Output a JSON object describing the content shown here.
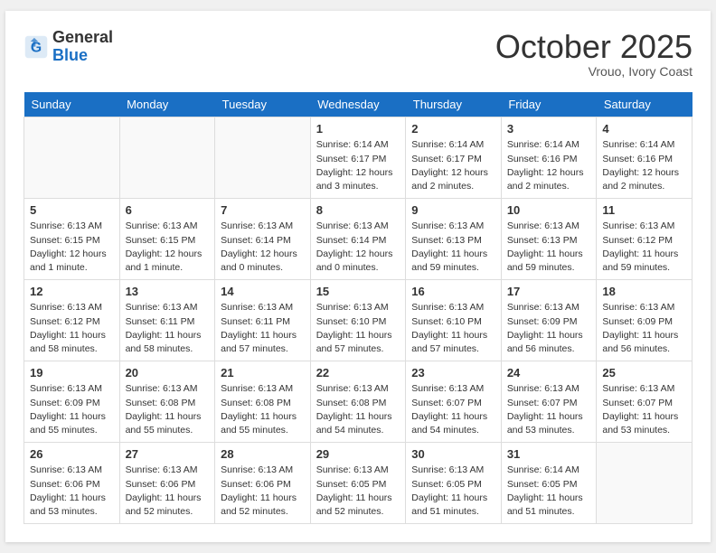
{
  "header": {
    "logo_general": "General",
    "logo_blue": "Blue",
    "month_title": "October 2025",
    "subtitle": "Vrouo, Ivory Coast"
  },
  "weekdays": [
    "Sunday",
    "Monday",
    "Tuesday",
    "Wednesday",
    "Thursday",
    "Friday",
    "Saturday"
  ],
  "weeks": [
    [
      {
        "day": "",
        "info": ""
      },
      {
        "day": "",
        "info": ""
      },
      {
        "day": "",
        "info": ""
      },
      {
        "day": "1",
        "info": "Sunrise: 6:14 AM\nSunset: 6:17 PM\nDaylight: 12 hours and 3 minutes."
      },
      {
        "day": "2",
        "info": "Sunrise: 6:14 AM\nSunset: 6:17 PM\nDaylight: 12 hours and 2 minutes."
      },
      {
        "day": "3",
        "info": "Sunrise: 6:14 AM\nSunset: 6:16 PM\nDaylight: 12 hours and 2 minutes."
      },
      {
        "day": "4",
        "info": "Sunrise: 6:14 AM\nSunset: 6:16 PM\nDaylight: 12 hours and 2 minutes."
      }
    ],
    [
      {
        "day": "5",
        "info": "Sunrise: 6:13 AM\nSunset: 6:15 PM\nDaylight: 12 hours and 1 minute."
      },
      {
        "day": "6",
        "info": "Sunrise: 6:13 AM\nSunset: 6:15 PM\nDaylight: 12 hours and 1 minute."
      },
      {
        "day": "7",
        "info": "Sunrise: 6:13 AM\nSunset: 6:14 PM\nDaylight: 12 hours and 0 minutes."
      },
      {
        "day": "8",
        "info": "Sunrise: 6:13 AM\nSunset: 6:14 PM\nDaylight: 12 hours and 0 minutes."
      },
      {
        "day": "9",
        "info": "Sunrise: 6:13 AM\nSunset: 6:13 PM\nDaylight: 11 hours and 59 minutes."
      },
      {
        "day": "10",
        "info": "Sunrise: 6:13 AM\nSunset: 6:13 PM\nDaylight: 11 hours and 59 minutes."
      },
      {
        "day": "11",
        "info": "Sunrise: 6:13 AM\nSunset: 6:12 PM\nDaylight: 11 hours and 59 minutes."
      }
    ],
    [
      {
        "day": "12",
        "info": "Sunrise: 6:13 AM\nSunset: 6:12 PM\nDaylight: 11 hours and 58 minutes."
      },
      {
        "day": "13",
        "info": "Sunrise: 6:13 AM\nSunset: 6:11 PM\nDaylight: 11 hours and 58 minutes."
      },
      {
        "day": "14",
        "info": "Sunrise: 6:13 AM\nSunset: 6:11 PM\nDaylight: 11 hours and 57 minutes."
      },
      {
        "day": "15",
        "info": "Sunrise: 6:13 AM\nSunset: 6:10 PM\nDaylight: 11 hours and 57 minutes."
      },
      {
        "day": "16",
        "info": "Sunrise: 6:13 AM\nSunset: 6:10 PM\nDaylight: 11 hours and 57 minutes."
      },
      {
        "day": "17",
        "info": "Sunrise: 6:13 AM\nSunset: 6:09 PM\nDaylight: 11 hours and 56 minutes."
      },
      {
        "day": "18",
        "info": "Sunrise: 6:13 AM\nSunset: 6:09 PM\nDaylight: 11 hours and 56 minutes."
      }
    ],
    [
      {
        "day": "19",
        "info": "Sunrise: 6:13 AM\nSunset: 6:09 PM\nDaylight: 11 hours and 55 minutes."
      },
      {
        "day": "20",
        "info": "Sunrise: 6:13 AM\nSunset: 6:08 PM\nDaylight: 11 hours and 55 minutes."
      },
      {
        "day": "21",
        "info": "Sunrise: 6:13 AM\nSunset: 6:08 PM\nDaylight: 11 hours and 55 minutes."
      },
      {
        "day": "22",
        "info": "Sunrise: 6:13 AM\nSunset: 6:08 PM\nDaylight: 11 hours and 54 minutes."
      },
      {
        "day": "23",
        "info": "Sunrise: 6:13 AM\nSunset: 6:07 PM\nDaylight: 11 hours and 54 minutes."
      },
      {
        "day": "24",
        "info": "Sunrise: 6:13 AM\nSunset: 6:07 PM\nDaylight: 11 hours and 53 minutes."
      },
      {
        "day": "25",
        "info": "Sunrise: 6:13 AM\nSunset: 6:07 PM\nDaylight: 11 hours and 53 minutes."
      }
    ],
    [
      {
        "day": "26",
        "info": "Sunrise: 6:13 AM\nSunset: 6:06 PM\nDaylight: 11 hours and 53 minutes."
      },
      {
        "day": "27",
        "info": "Sunrise: 6:13 AM\nSunset: 6:06 PM\nDaylight: 11 hours and 52 minutes."
      },
      {
        "day": "28",
        "info": "Sunrise: 6:13 AM\nSunset: 6:06 PM\nDaylight: 11 hours and 52 minutes."
      },
      {
        "day": "29",
        "info": "Sunrise: 6:13 AM\nSunset: 6:05 PM\nDaylight: 11 hours and 52 minutes."
      },
      {
        "day": "30",
        "info": "Sunrise: 6:13 AM\nSunset: 6:05 PM\nDaylight: 11 hours and 51 minutes."
      },
      {
        "day": "31",
        "info": "Sunrise: 6:14 AM\nSunset: 6:05 PM\nDaylight: 11 hours and 51 minutes."
      },
      {
        "day": "",
        "info": ""
      }
    ]
  ]
}
